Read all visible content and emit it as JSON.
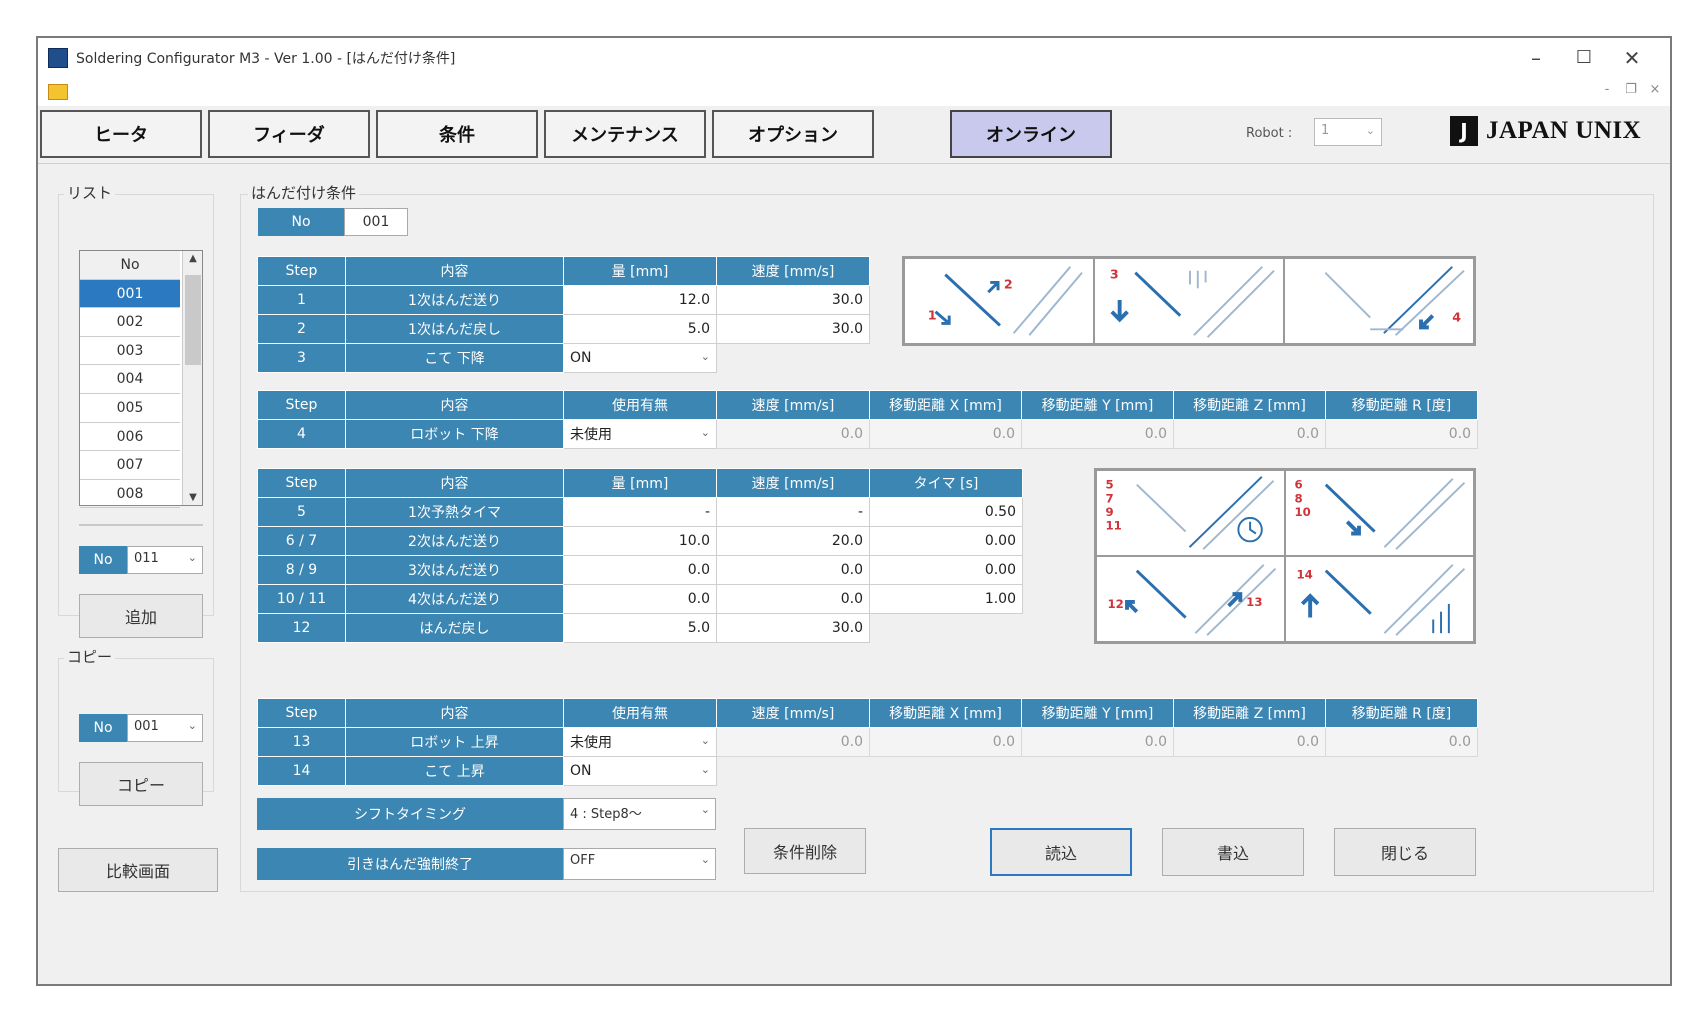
{
  "window": {
    "title": "Soldering Configurator M3 - Ver 1.00 - [はんだ付け条件]",
    "controls": {
      "minimize": "–",
      "maximize": "☐",
      "close": "✕"
    },
    "mdi_controls": {
      "minimize": "-",
      "restore": "❐",
      "close": "×"
    }
  },
  "toolbar": {
    "tabs": [
      "ヒータ",
      "フィーダ",
      "条件",
      "メンテナンス",
      "オプション"
    ],
    "online": "オンライン",
    "robot_label": "Robot :",
    "robot_value": "1",
    "logo_mark": "J",
    "logo_text": "JAPAN UNIX"
  },
  "list_panel": {
    "label": "リスト",
    "header": "No",
    "items": [
      "001",
      "002",
      "003",
      "004",
      "005",
      "006",
      "007",
      "008"
    ],
    "selected": "001",
    "no_label": "No",
    "no_value": "011",
    "add_button": "追加"
  },
  "copy_panel": {
    "label": "コピー",
    "no_label": "No",
    "no_value": "001",
    "copy_button": "コピー"
  },
  "compare_button": "比較画面",
  "main": {
    "label": "はんだ付け条件",
    "no_label": "No",
    "no_value": "001",
    "table1": {
      "headers": [
        "Step",
        "内容",
        "量 [mm]",
        "速度 [mm/s]"
      ],
      "rows": [
        {
          "step": "1",
          "name": "1次はんだ送り",
          "amount": "12.0",
          "speed": "30.0"
        },
        {
          "step": "2",
          "name": "1次はんだ戻し",
          "amount": "5.0",
          "speed": "30.0"
        },
        {
          "step": "3",
          "name": "こて 下降",
          "select": "ON"
        }
      ]
    },
    "table2": {
      "headers": [
        "Step",
        "内容",
        "使用有無",
        "速度 [mm/s]",
        "移動距離 X [mm]",
        "移動距離 Y [mm]",
        "移動距離 Z [mm]",
        "移動距離 R [度]"
      ],
      "row": {
        "step": "4",
        "name": "ロボット 下降",
        "select": "未使用",
        "values": [
          "0.0",
          "0.0",
          "0.0",
          "0.0",
          "0.0"
        ]
      }
    },
    "table3": {
      "headers": [
        "Step",
        "内容",
        "量 [mm]",
        "速度 [mm/s]",
        "タイマ [s]"
      ],
      "rows": [
        {
          "step": "5",
          "name": "1次予熱タイマ",
          "amount": "-",
          "speed": "-",
          "timer": "0.50"
        },
        {
          "step": "6 / 7",
          "name": "2次はんだ送り",
          "amount": "10.0",
          "speed": "20.0",
          "timer": "0.00"
        },
        {
          "step": "8 / 9",
          "name": "3次はんだ送り",
          "amount": "0.0",
          "speed": "0.0",
          "timer": "0.00"
        },
        {
          "step": "10 / 11",
          "name": "4次はんだ送り",
          "amount": "0.0",
          "speed": "0.0",
          "timer": "1.00"
        },
        {
          "step": "12",
          "name": "はんだ戻し",
          "amount": "5.0",
          "speed": "30.0"
        }
      ]
    },
    "table4": {
      "headers": [
        "Step",
        "内容",
        "使用有無",
        "速度 [mm/s]",
        "移動距離 X [mm]",
        "移動距離 Y [mm]",
        "移動距離 Z [mm]",
        "移動距離 R [度]"
      ],
      "rows": [
        {
          "step": "13",
          "name": "ロボット 上昇",
          "select": "未使用",
          "values": [
            "0.0",
            "0.0",
            "0.0",
            "0.0",
            "0.0"
          ]
        },
        {
          "step": "14",
          "name": "こて 上昇",
          "select": "ON"
        }
      ]
    },
    "shift_timing": {
      "label": "シフトタイミング",
      "value": "4 : Step8〜"
    },
    "pull_solder": {
      "label": "引きはんだ強制終了",
      "value": "OFF"
    },
    "delete_button": "条件削除",
    "read_button": "読込",
    "write_button": "書込",
    "close_button": "閉じる"
  },
  "diagram_labels": {
    "top": [
      "1",
      "2",
      "3",
      "4"
    ],
    "bottom": [
      "5\n7\n9\n11",
      "6\n8\n10",
      "12",
      "13",
      "14"
    ]
  },
  "colors": {
    "header_blue": "#3b86b2",
    "online_bg": "#c9c9ee",
    "selected_blue": "#2b7ac1",
    "diagram_red": "#d0343a",
    "diagram_blue": "#2a6fb0"
  }
}
